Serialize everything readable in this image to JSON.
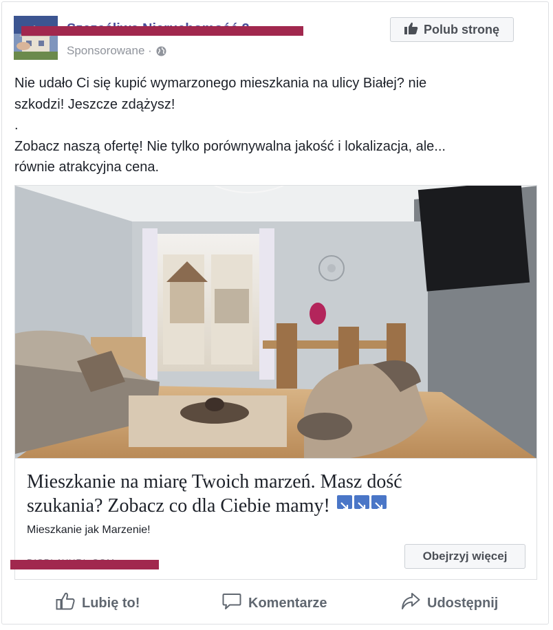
{
  "post": {
    "page_name": "Szczęśliwa Nieruchomość 2",
    "sponsored_label": "Sponsorowane · ",
    "like_page_button": "Polub stronę",
    "text_lines": [
      "Nie udało Ci się kupić wymarzonego mieszkania na ulicy Białej? nie",
      "szkodzi! Jeszcze zdążysz!",
      ".",
      "Zobacz naszą ofertę! Nie tylko porównywalna jakość i lokalizacja, ale...",
      "równie atrakcyjna cena."
    ]
  },
  "link": {
    "headline_line1": "Mieszkanie na miarę Twoich marzeń. Masz dość",
    "headline_line2": "szukania? Zobacz co dla Ciebie mamy!",
    "subtitle": "Mieszkanie jak Marzenie!",
    "display_url": "DISPLAYURL.COM",
    "cta_button": "Obejrzyj więcej"
  },
  "actions": {
    "like": "Lubię to!",
    "comment": "Komentarze",
    "share": "Udostępnij"
  },
  "icons": {
    "globe": "globe-icon",
    "thumb": "thumbs-up-icon",
    "comment": "comment-icon",
    "share": "share-icon",
    "arrow": "arrow-down-right-icon"
  },
  "colors": {
    "redaction": "#a1284e",
    "arrow_badge": "#4a76c7",
    "page_name": "#4b4f9a"
  }
}
